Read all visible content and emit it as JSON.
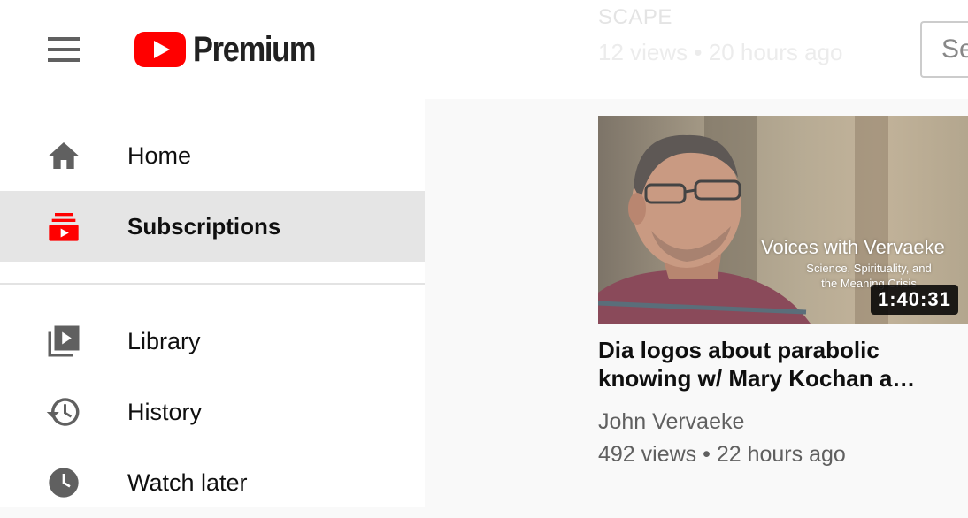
{
  "header": {
    "logo_text": "Premium",
    "search_placeholder": "Se",
    "faded_video": {
      "title_fragment": "SCAPE",
      "views": "12 views",
      "age": "20 hours ago",
      "separator": "•"
    }
  },
  "sidebar": {
    "items": [
      {
        "label": "Home",
        "icon": "home-icon",
        "active": false
      },
      {
        "label": "Subscriptions",
        "icon": "subscriptions-icon",
        "active": true
      },
      {
        "label": "Library",
        "icon": "library-icon",
        "active": false
      },
      {
        "label": "History",
        "icon": "history-icon",
        "active": false
      },
      {
        "label": "Watch later",
        "icon": "watch-later-icon",
        "active": false
      }
    ]
  },
  "video": {
    "thumbnail_text": {
      "title": "Voices with Vervaeke",
      "subtitle_line1": "Science, Spirituality, and",
      "subtitle_line2": "the Meaning Crisis"
    },
    "duration": "1:40:31",
    "title_line1": "Dia logos about parabolic",
    "title_line2": "knowing w/ Mary Kochan a…",
    "channel": "John Vervaeke",
    "views": "492 views",
    "separator": "•",
    "age": "22 hours ago"
  },
  "colors": {
    "brand_red": "#ff0000",
    "active_icon_red": "#ff0000",
    "icon_gray": "#606060",
    "active_bg": "#e5e5e5",
    "content_bg": "#f9f9f9"
  }
}
